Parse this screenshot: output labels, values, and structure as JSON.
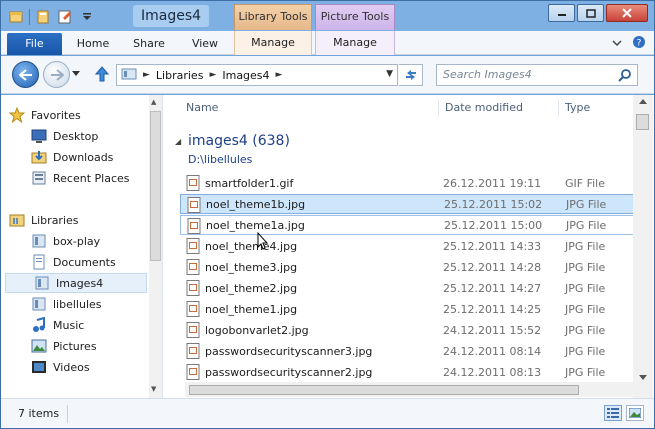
{
  "titlebar": {
    "title": "Images4",
    "context_library": "Library Tools",
    "context_picture": "Picture Tools"
  },
  "ribbon": {
    "tabs": [
      "File",
      "Home",
      "Share",
      "View",
      "Manage",
      "Manage"
    ]
  },
  "address": {
    "crumbs": [
      "Libraries",
      "Images4"
    ],
    "search_placeholder": "Search Images4"
  },
  "nav": {
    "favorites_header": "Favorites",
    "favorites": [
      "Desktop",
      "Downloads",
      "Recent Places"
    ],
    "libraries_header": "Libraries",
    "libraries": [
      "box-play",
      "Documents",
      "Images4",
      "libellules",
      "Music",
      "Pictures",
      "Videos"
    ],
    "selected": "Images4"
  },
  "columns": {
    "name": "Name",
    "date": "Date modified",
    "type": "Type"
  },
  "group": {
    "title": "images4 (638)",
    "path": "D:\\libellules"
  },
  "files": [
    {
      "name": "smartfolder1.gif",
      "date": "26.12.2011 19:11",
      "type": "GIF File"
    },
    {
      "name": "noel_theme1b.jpg",
      "date": "25.12.2011 15:02",
      "type": "JPG File"
    },
    {
      "name": "noel_theme1a.jpg",
      "date": "25.12.2011 15:00",
      "type": "JPG File"
    },
    {
      "name": "noel_theme4.jpg",
      "date": "25.12.2011 14:33",
      "type": "JPG File"
    },
    {
      "name": "noel_theme3.jpg",
      "date": "25.12.2011 14:28",
      "type": "JPG File"
    },
    {
      "name": "noel_theme2.jpg",
      "date": "25.12.2011 14:27",
      "type": "JPG File"
    },
    {
      "name": "noel_theme1.jpg",
      "date": "25.12.2011 14:25",
      "type": "JPG File"
    },
    {
      "name": "logobonvarlet2.jpg",
      "date": "24.12.2011 15:52",
      "type": "JPG File"
    },
    {
      "name": "passwordsecurityscanner3.jpg",
      "date": "24.12.2011 08:14",
      "type": "JPG File"
    },
    {
      "name": "passwordsecurityscanner2.jpg",
      "date": "24.12.2011 08:13",
      "type": "JPG File"
    }
  ],
  "status": {
    "items": "7 items"
  },
  "colors": {
    "accent": "#1a56a8",
    "selection": "#cde6fb",
    "group_title": "#1e3f8a"
  }
}
